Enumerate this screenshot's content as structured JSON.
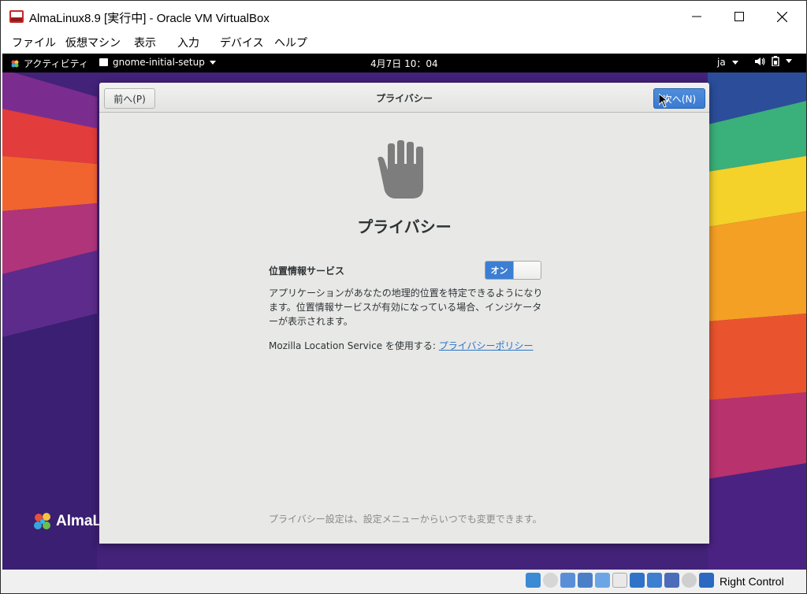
{
  "window": {
    "title": "AlmaLinux8.9 [実行中] - Oracle VM VirtualBox",
    "minimize_icon": "minimize-icon",
    "maximize_icon": "maximize-icon",
    "close_icon": "close-icon"
  },
  "menubar": {
    "items": [
      "ファイル",
      "仮想マシン",
      "表示",
      "入力",
      "デバイス",
      "ヘルプ"
    ]
  },
  "topbar": {
    "activities": "アクティビティ",
    "app_name": "gnome-initial-setup",
    "clock": "4月7日 10：04",
    "language": "ja",
    "status_icons": [
      "volume-icon",
      "battery-icon"
    ]
  },
  "desktop": {
    "logo_text": "AlmaL"
  },
  "dialog": {
    "prev_label": "前へ(P)",
    "header_title": "プライバシー",
    "next_label": "次へ(N)",
    "icon": "hand-privacy-icon",
    "page_title": "プライバシー",
    "location_label": "位置情報サービス",
    "switch_label": "オン",
    "switch_state": "on",
    "location_desc": "アプリケーションがあなたの地理的位置を特定できるようになります。位置情報サービスが有効になっている場合、インジケーターが表示されます。",
    "mls_prefix": "Mozilla Location Service を使用する: ",
    "policy_link": "プライバシーポリシー",
    "footer_note": "プライバシー設定は、設定メニューからいつでも変更できます。"
  },
  "statusbar": {
    "icons": [
      "hard-disk-icon",
      "optical-drive-icon",
      "audio-icon",
      "network-icon",
      "usb-icon",
      "shared-folders-icon",
      "display-icon",
      "video-capture-icon",
      "virtualization-icon",
      "mouse-integration-icon",
      "host-key-icon"
    ],
    "host_key": "Right Control"
  },
  "colors": {
    "accent": "#3b7ed3",
    "link": "#2a76c6",
    "dialog_bg": "#e8e8e7",
    "topbar_bg": "#000000"
  }
}
